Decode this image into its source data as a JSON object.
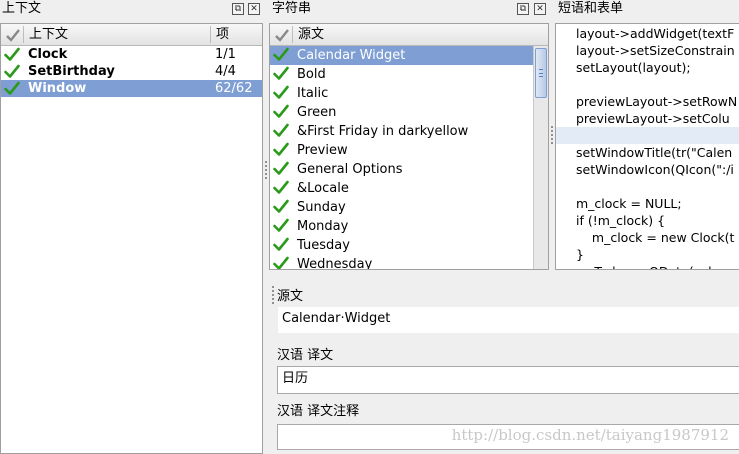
{
  "docks": {
    "context": {
      "title": "上下文"
    },
    "strings": {
      "title": "字符串"
    },
    "phrases": {
      "title": "短语和表单"
    }
  },
  "context_list": {
    "headers": {
      "context": "上下文",
      "items": "项"
    },
    "rows": [
      {
        "name": "Clock",
        "count": "1/1",
        "selected": false
      },
      {
        "name": "SetBirthday",
        "count": "4/4",
        "selected": false
      },
      {
        "name": "Window",
        "count": "62/62",
        "selected": true
      }
    ]
  },
  "strings_list": {
    "headers": {
      "source": "源文"
    },
    "rows": [
      {
        "name": "Calendar Widget",
        "selected": true
      },
      {
        "name": "Bold",
        "selected": false
      },
      {
        "name": "Italic",
        "selected": false
      },
      {
        "name": "Green",
        "selected": false
      },
      {
        "name": "&First Friday in darkyellow",
        "selected": false
      },
      {
        "name": "Preview",
        "selected": false
      },
      {
        "name": "General Options",
        "selected": false
      },
      {
        "name": "&Locale",
        "selected": false
      },
      {
        "name": "Sunday",
        "selected": false
      },
      {
        "name": "Monday",
        "selected": false
      },
      {
        "name": "Tuesday",
        "selected": false
      },
      {
        "name": "Wednesday",
        "selected": false
      }
    ]
  },
  "code_lines": [
    "layout->addWidget(textF",
    "layout->setSizeConstrain",
    "setLayout(layout);",
    "",
    "previewLayout->setRowN",
    "previewLayout->setColu",
    "",
    "setWindowTitle(tr(\"Calen",
    "setWindowIcon(QIcon(\":/i",
    "",
    "m_clock = NULL;",
    "if (!m_clock) {",
    "    m_clock = new Clock(t",
    "}",
    "m_Today = QDate(calenc"
  ],
  "current_code_line": 6,
  "editor": {
    "source_label": "源文",
    "source_text": "Calendar·Widget",
    "translation_label": "汉语 译文",
    "translation_text": "日历",
    "comment_label": "汉语 译文注释",
    "comment_text": ""
  },
  "watermark": "http://blog.csdn.net/taiyang1987912",
  "colors": {
    "selection": "#7f9fd4",
    "check_green": "#2a9a1a",
    "current_line": "#e3ebf7"
  }
}
